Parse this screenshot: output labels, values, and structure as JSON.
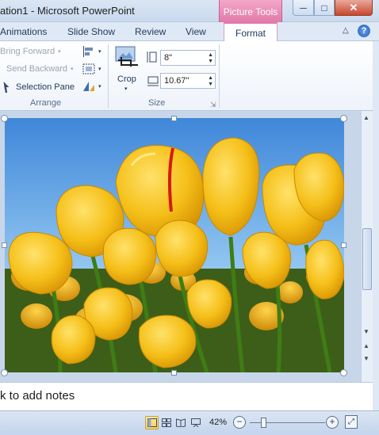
{
  "window": {
    "title": "ation1  -  Microsoft PowerPoint",
    "context_tab": "Picture Tools",
    "buttons": {
      "minimize": "─",
      "maximize": "□",
      "close": "✕"
    }
  },
  "tabs": [
    {
      "label": "Animations"
    },
    {
      "label": "Slide Show"
    },
    {
      "label": "Review"
    },
    {
      "label": "View"
    },
    {
      "label": "Format",
      "active": true
    }
  ],
  "help_label": "?",
  "ribbon": {
    "arrange": {
      "bring_forward": "Bring Forward",
      "send_backward": "Send Backward",
      "selection_pane": "Selection Pane",
      "label": "Arrange"
    },
    "size": {
      "crop": "Crop",
      "height": "8\"",
      "width": "10.67\"",
      "label": "Size"
    }
  },
  "notes": {
    "text": "k to add notes"
  },
  "status": {
    "zoom": "42%",
    "zoom_fraction": 0.18
  },
  "colors": {
    "context_tab": "#e27aa9",
    "ribbon_bg": "#eef3fa",
    "sky": "#7eb6ea",
    "tulip": "#f5c21b"
  }
}
